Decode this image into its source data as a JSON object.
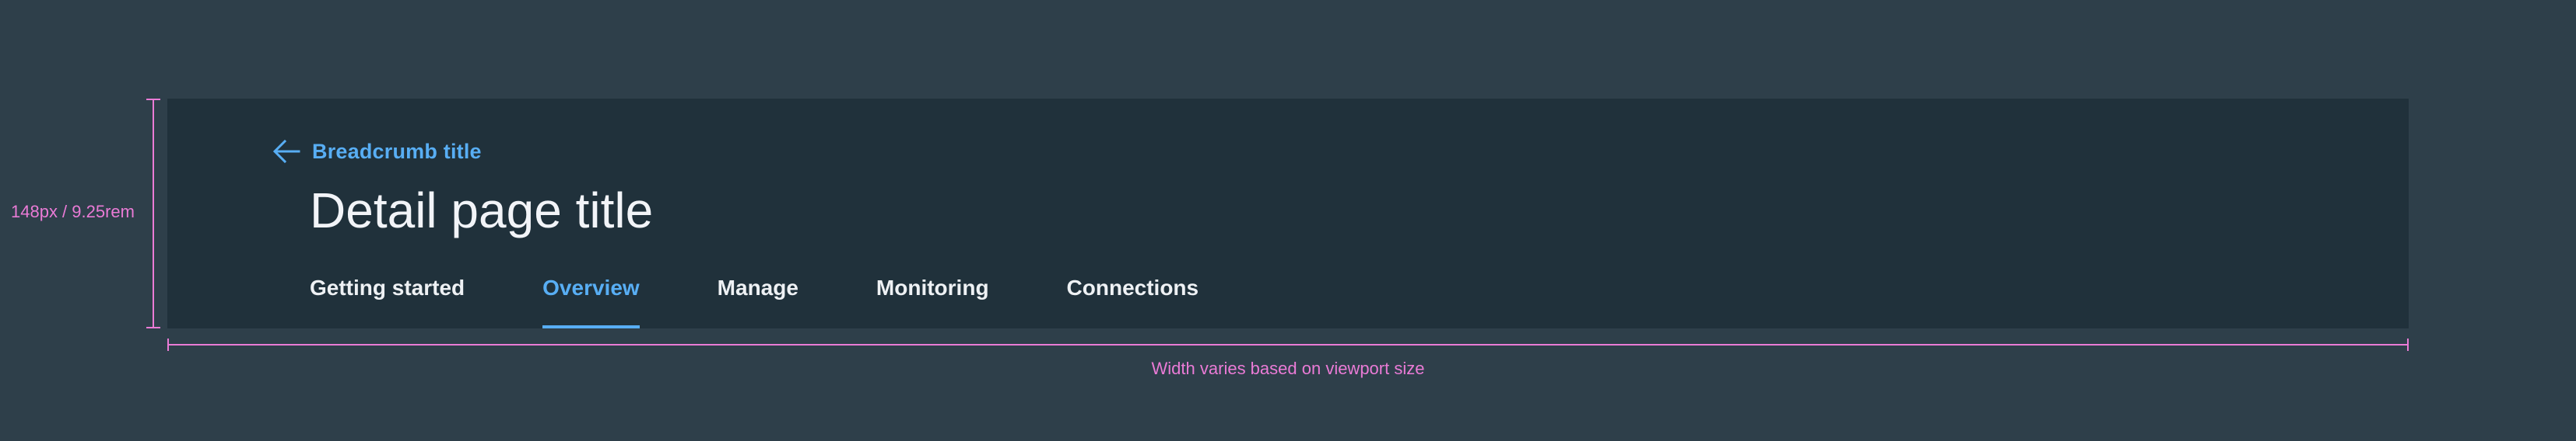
{
  "breadcrumb": {
    "label": "Breadcrumb title",
    "icon": "arrow-left-icon"
  },
  "page": {
    "title": "Detail page title"
  },
  "tabs": [
    {
      "label": "Getting started",
      "active": false
    },
    {
      "label": "Overview",
      "active": true
    },
    {
      "label": "Manage",
      "active": false
    },
    {
      "label": "Monitoring",
      "active": false
    },
    {
      "label": "Connections",
      "active": false
    }
  ],
  "annotations": {
    "height_label": "148px / 9.25rem",
    "width_label": "Width varies based on viewport size"
  },
  "colors": {
    "background": "#2e3f4a",
    "panel": "#20313b",
    "accent": "#58aef4",
    "text": "#f2f4f8",
    "annotation": "#ea7bd6"
  }
}
